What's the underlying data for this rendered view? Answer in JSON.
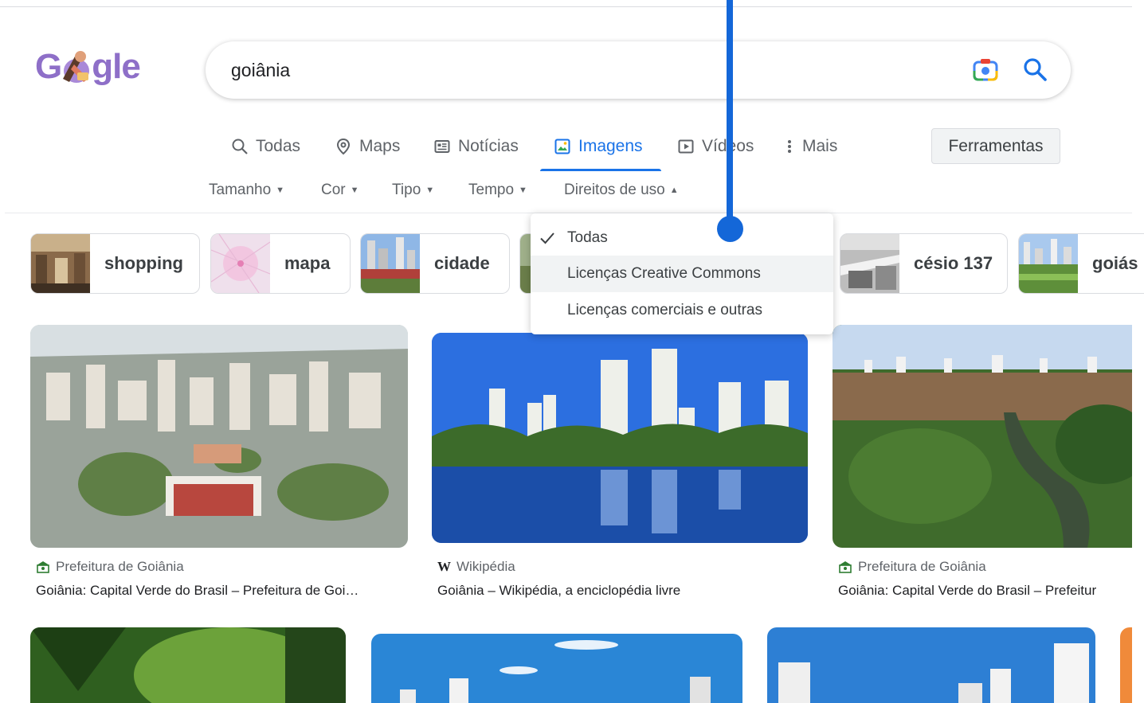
{
  "logo": {
    "text_left": "G",
    "text_right": "gle"
  },
  "search": {
    "query": "goiânia"
  },
  "tabs": [
    {
      "label": "Todas",
      "icon": "search-icon"
    },
    {
      "label": "Maps",
      "icon": "map-pin-icon"
    },
    {
      "label": "Notícias",
      "icon": "news-icon"
    },
    {
      "label": "Imagens",
      "icon": "image-icon",
      "active": true
    },
    {
      "label": "Vídeos",
      "icon": "play-icon"
    },
    {
      "label": "Mais",
      "icon": "more-vert-icon"
    }
  ],
  "tools_button": "Ferramentas",
  "filters": [
    {
      "label": "Tamanho",
      "caret": "▼"
    },
    {
      "label": "Cor",
      "caret": "▼"
    },
    {
      "label": "Tipo",
      "caret": "▼"
    },
    {
      "label": "Tempo",
      "caret": "▼"
    },
    {
      "label": "Direitos de uso",
      "caret": "▲"
    }
  ],
  "usage_rights_menu": {
    "items": [
      {
        "label": "Todas",
        "checked": true
      },
      {
        "label": "Licenças Creative Commons",
        "highlighted": true
      },
      {
        "label": "Licenças comerciais e outras"
      }
    ]
  },
  "chips": [
    {
      "label": "shopping"
    },
    {
      "label": "mapa"
    },
    {
      "label": "cidade"
    },
    {
      "label": "césio 137"
    },
    {
      "label": "goiás"
    }
  ],
  "results": [
    {
      "source": "Prefeitura de Goiânia",
      "title": "Goiânia: Capital Verde do Brasil – Prefeitura de Goi…"
    },
    {
      "source": "Wikipédia",
      "title": "Goiânia – Wikipédia, a enciclopédia livre"
    },
    {
      "source": "Prefeitura de Goiânia",
      "title": "Goiânia: Capital Verde do Brasil – Prefeitur"
    }
  ],
  "colors": {
    "accent": "#1a73e8",
    "pointer": "#1467d8",
    "logo": "#8e6fc8"
  }
}
